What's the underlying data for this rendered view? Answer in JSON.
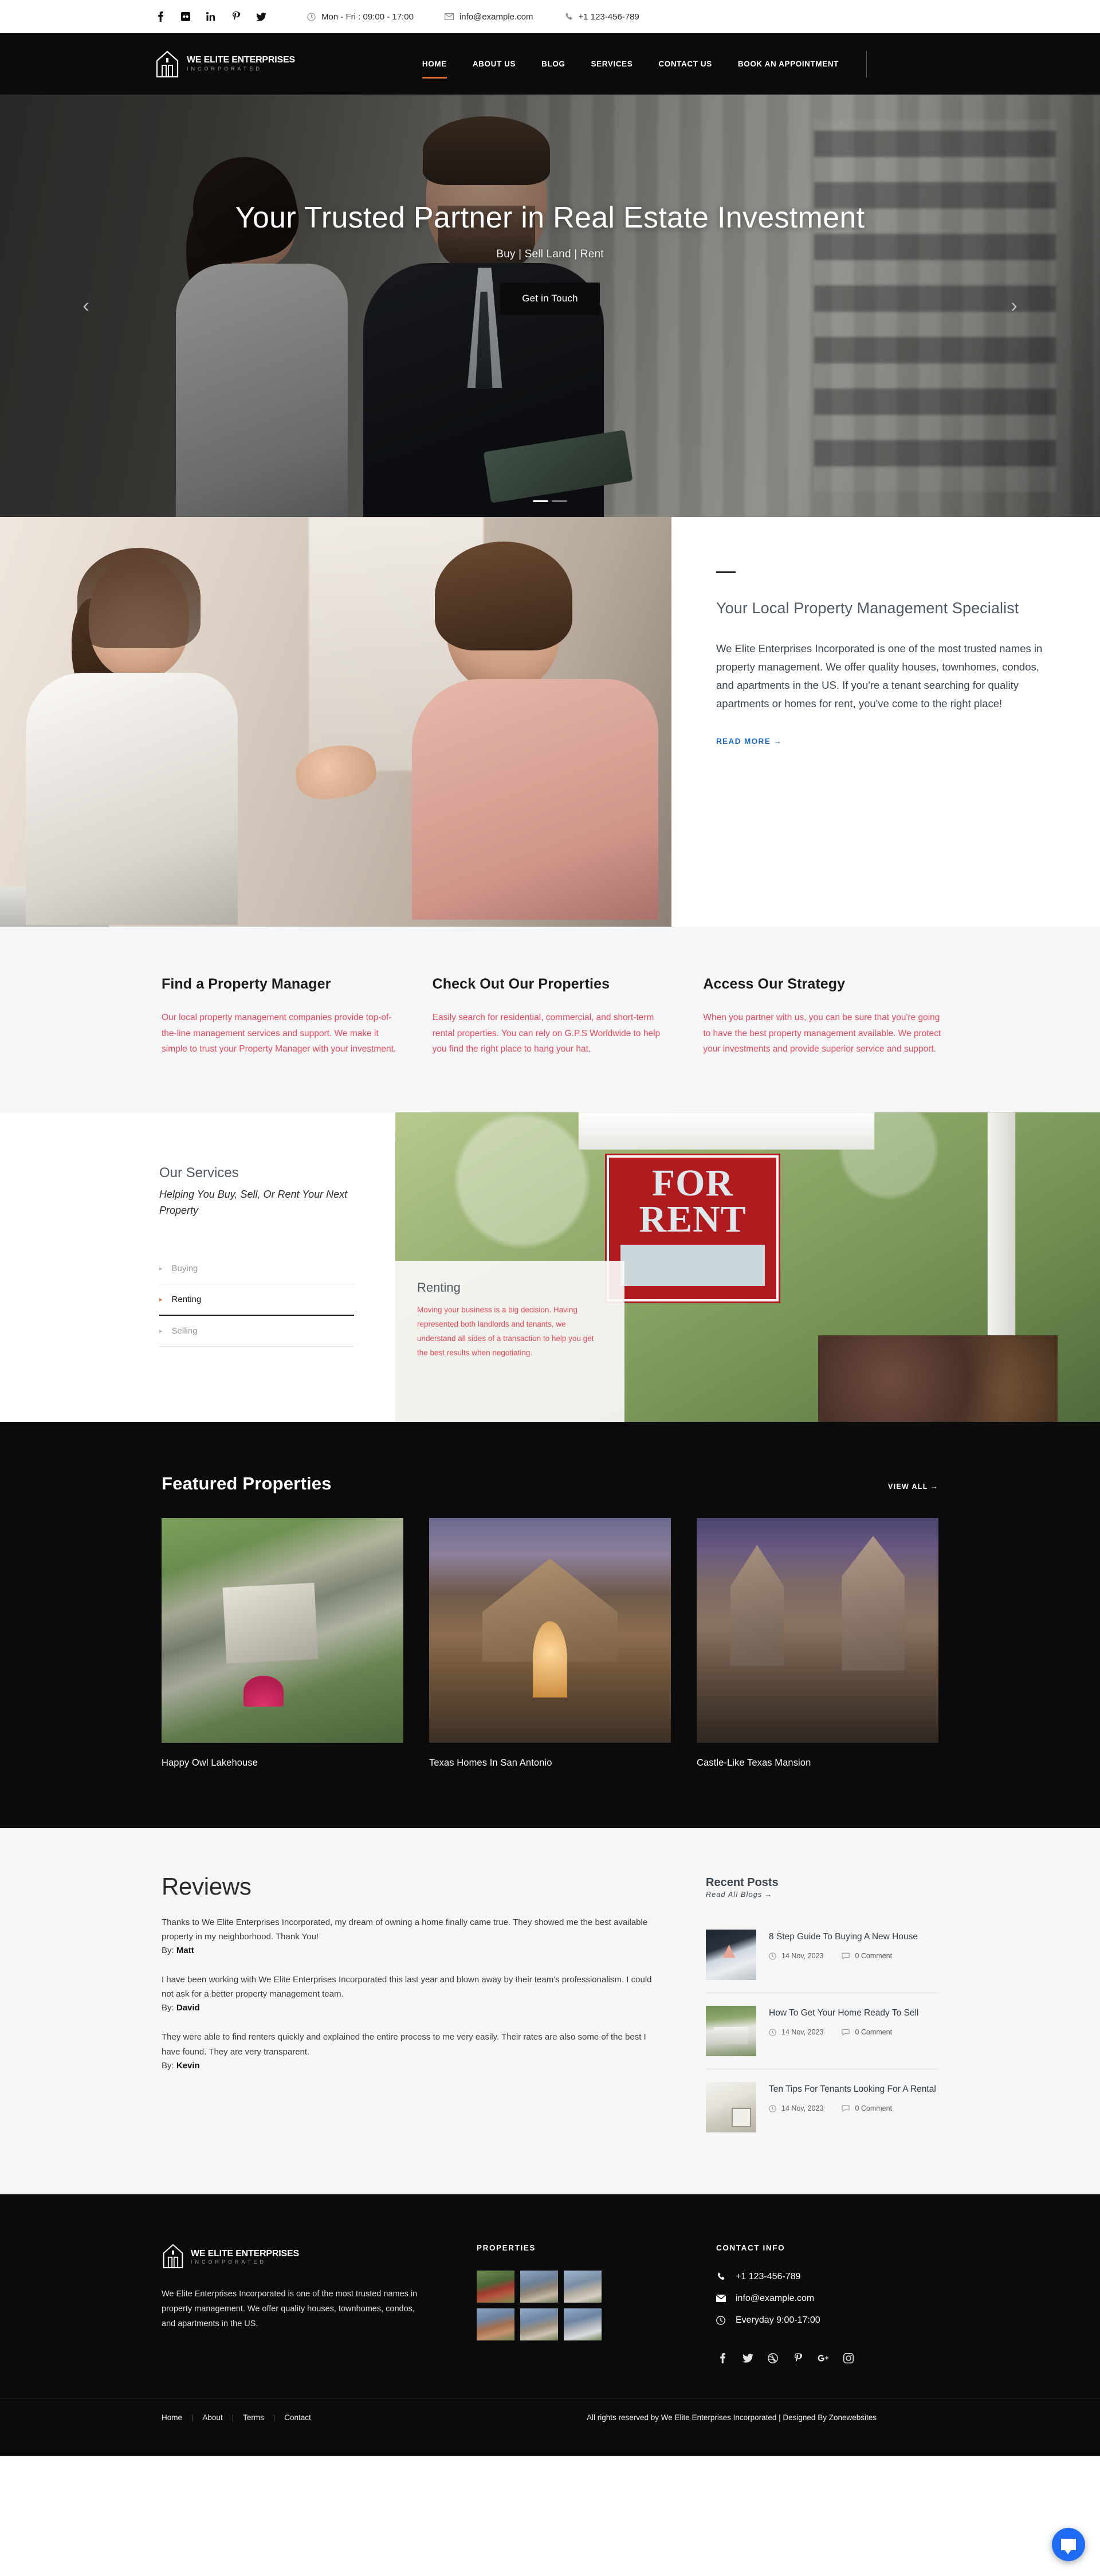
{
  "topbar": {
    "social": [
      {
        "name": "facebook-icon",
        "glyph": "f"
      },
      {
        "name": "flickr-icon",
        "glyph": "■"
      },
      {
        "name": "linkedin-icon",
        "glyph": "in"
      },
      {
        "name": "pinterest-icon",
        "glyph": "р"
      },
      {
        "name": "twitter-icon",
        "glyph": "ᴠ"
      }
    ],
    "hours": "Mon - Fri : 09:00 - 17:00",
    "email": "info@example.com",
    "phone": "+1 123-456-789"
  },
  "header": {
    "brand_name": "WE ELITE ENTERPRISES",
    "brand_sub": "INCORPORATED",
    "nav": [
      {
        "label": "HOME",
        "active": true
      },
      {
        "label": "ABOUT US",
        "active": false
      },
      {
        "label": "BLOG",
        "active": false
      },
      {
        "label": "SERVICES",
        "active": false
      },
      {
        "label": "CONTACT US",
        "active": false
      },
      {
        "label": "BOOK AN APPOINTMENT",
        "active": false
      }
    ]
  },
  "hero": {
    "title": "Your Trusted Partner in Real Estate Investment",
    "subtitle": "Buy | Sell Land | Rent",
    "button": "Get in Touch",
    "prev": "‹",
    "next": "›"
  },
  "about": {
    "heading": "Your Local Property Management Specialist",
    "paragraph": "We Elite Enterprises Incorporated is one of the most trusted names in property management. We offer quality houses, townhomes, condos, and apartments in the US. If you're a tenant searching for quality apartments or homes for rent, you've come to the right place!",
    "read_more": "READ MORE →"
  },
  "features": [
    {
      "title": "Find a Property Manager",
      "text": "Our local property management companies provide top-of-the-line management services and support. We make it simple to trust your Property Manager with your investment."
    },
    {
      "title": "Check Out Our Properties",
      "text": "Easily search for residential, commercial, and short-term rental properties. You can rely on G.P.S Worldwide to help you find the right place to hang your hat."
    },
    {
      "title": "Access Our Strategy",
      "text": "When you partner with us, you can be sure that you're going to have the best property management available. We protect your investments and provide superior service and support."
    }
  ],
  "services": {
    "heading": "Our Services",
    "subheading": "Helping You Buy, Sell, Or Rent Your Next Property",
    "items": [
      {
        "label": "Buying",
        "active": false
      },
      {
        "label": "Renting",
        "active": true
      },
      {
        "label": "Selling",
        "active": false
      }
    ],
    "card": {
      "title": "Renting",
      "text": "Moving your business is a big decision. Having represented both landlords and tenants, we understand all sides of a transaction to help you get the best results when negotiating."
    },
    "sign_line1": "FOR",
    "sign_line2": "RENT"
  },
  "featured": {
    "title": "Featured Properties",
    "view_all": "VIEW ALL →",
    "properties": [
      {
        "name": "Happy Owl Lakehouse"
      },
      {
        "name": "Texas Homes In San Antonio"
      },
      {
        "name": "Castle-Like Texas Mansion"
      }
    ]
  },
  "reviews": {
    "heading": "Reviews",
    "items": [
      {
        "text": "Thanks to We Elite Enterprises Incorporated, my dream of owning a home finally came true. They showed me the best available property in my neighborhood. Thank You!",
        "by_label": "By:",
        "author": "Matt"
      },
      {
        "text": "I have been working with We Elite Enterprises Incorporated this last year and blown away by their team's professionalism. I could not ask for a better property management team.",
        "by_label": "By:",
        "author": "David"
      },
      {
        "text": "They were able to find renters quickly and explained the entire process to me very easily. Their rates are also some of the best I have found. They are very transparent.",
        "by_label": "By:",
        "author": "Kevin"
      }
    ]
  },
  "recent_posts": {
    "heading": "Recent Posts",
    "read_all": "Read All Blogs →",
    "posts": [
      {
        "title": "8 Step Guide To Buying A New House",
        "date": "14 Nov, 2023",
        "comments": "0 Comment"
      },
      {
        "title": "How To Get Your Home Ready To Sell",
        "date": "14 Nov, 2023",
        "comments": "0 Comment"
      },
      {
        "title": "Ten Tips For Tenants Looking For A Rental",
        "date": "14 Nov, 2023",
        "comments": "0 Comment"
      }
    ]
  },
  "footer": {
    "brand_name": "WE ELITE ENTERPRISES",
    "brand_sub": "INCORPORATED",
    "description": "We Elite Enterprises Incorporated is one of the most trusted names in property management. We offer quality houses, townhomes, condos, and apartments in the US.",
    "properties_heading": "PROPERTIES",
    "contact_heading": "CONTACT INFO",
    "phone": "+1 123-456-789",
    "email": "info@example.com",
    "hours": "Everyday 9:00-17:00",
    "social": [
      {
        "name": "facebook-icon",
        "glyph": "f"
      },
      {
        "name": "twitter-icon",
        "glyph": "ᴠ"
      },
      {
        "name": "dribbble-icon",
        "glyph": "◎"
      },
      {
        "name": "pinterest-icon",
        "glyph": "р"
      },
      {
        "name": "google-plus-icon",
        "glyph": "g⁺"
      },
      {
        "name": "instagram-icon",
        "glyph": "▣"
      }
    ],
    "bottom_links": [
      "Home",
      "About",
      "Terms",
      "Contact"
    ],
    "copyright": "All rights reserved by We Elite Enterprises Incorporated | Designed By Zonewebsites"
  },
  "colors": {
    "accent": "#e2703a",
    "dark": "#0b0b0b",
    "link": "#1565c0",
    "feature_text": "#e8495f",
    "chat": "#1f6bf5"
  }
}
